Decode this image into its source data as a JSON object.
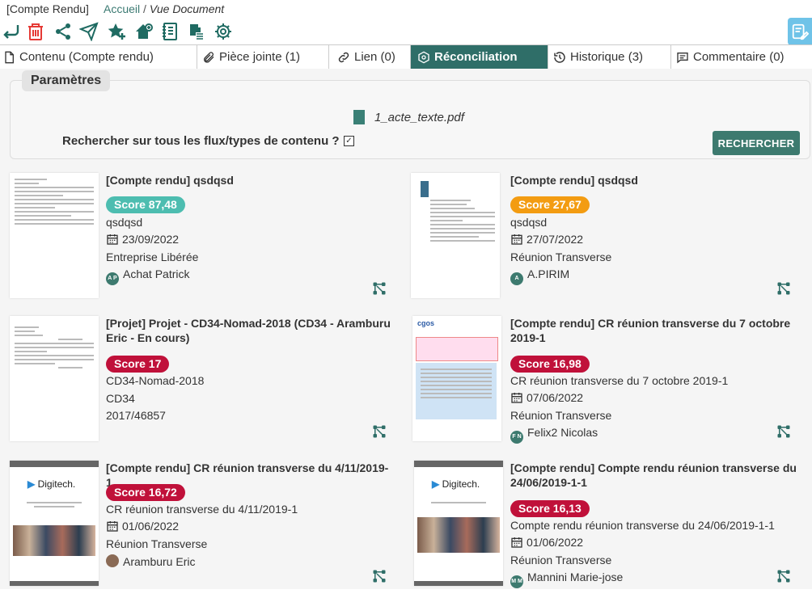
{
  "header": {
    "context": "[Compte Rendu]",
    "crumb_home": "Accueil",
    "crumb_sep": "/",
    "crumb_current": "Vue Document"
  },
  "toolbar": {
    "icons": [
      "back-icon",
      "trash-icon",
      "share-icon",
      "send-icon",
      "star-add-icon",
      "home-add-icon",
      "notebook-icon",
      "clipboard-list-icon",
      "gear-icon",
      "edit-note-icon"
    ]
  },
  "tabs": [
    {
      "label": "Contenu (Compte rendu)",
      "icon": "document-icon"
    },
    {
      "label": "Pièce jointe (1)",
      "icon": "paperclip-icon"
    },
    {
      "label": "Lien (0)",
      "icon": "link-icon"
    },
    {
      "label": "Réconciliation",
      "icon": "hexagon-icon",
      "active": true
    },
    {
      "label": "Historique (3)",
      "icon": "history-icon"
    },
    {
      "label": "Commentaire (0)",
      "icon": "comment-icon"
    }
  ],
  "params": {
    "title": "Paramètres",
    "filename": "1_acte_texte.pdf",
    "search_label": "Rechercher sur tous les flux/types de contenu ?",
    "search_checked": true,
    "search_button": "RECHERCHER"
  },
  "results": [
    {
      "title": "[Compte rendu] qsdqsd",
      "score": "Score 87,48",
      "score_color": "#4dbdb0",
      "lines": [
        "qsdqsd"
      ],
      "date": "23/09/2022",
      "org": "Entreprise Libérée",
      "author": "Achat Patrick",
      "initials": "A P"
    },
    {
      "title": "[Compte rendu] qsdqsd",
      "score": "Score 27,67",
      "score_color": "#f39c12",
      "lines": [
        "qsdqsd"
      ],
      "date": "27/07/2022",
      "org": "Réunion Transverse",
      "author": "A.PIRIM",
      "initials": "A"
    },
    {
      "title": "[Projet] Projet - CD34-Nomad-2018 (CD34 - Aramburu Eric - En cours)",
      "score": "Score 17",
      "score_color": "#c0113a",
      "lines": [
        "CD34-Nomad-2018",
        "CD34",
        "2017/46857"
      ]
    },
    {
      "title": "[Compte rendu] CR réunion transverse du 7 octobre 2019-1",
      "score": "Score 16,98",
      "score_color": "#c0113a",
      "lines": [
        "CR réunion transverse du 7 octobre 2019-1"
      ],
      "date": "07/06/2022",
      "org": "Réunion Transverse",
      "author": "Felix2 Nicolas",
      "initials": "F N"
    },
    {
      "title": "[Compte rendu] CR réunion transverse du 4/11/2019-1",
      "score": "Score 16,72",
      "score_color": "#c0113a",
      "lines": [
        "CR réunion transverse du 4/11/2019-1"
      ],
      "date": "01/06/2022",
      "org": "Réunion Transverse",
      "author": "Aramburu Eric",
      "initials": ""
    },
    {
      "title": "[Compte rendu] Compte rendu réunion transverse du 24/06/2019-1-1",
      "score": "Score 16,13",
      "score_color": "#c0113a",
      "lines": [
        "Compte rendu réunion transverse du 24/06/2019-1-1"
      ],
      "date": "01/06/2022",
      "org": "Réunion Transverse",
      "author": "Mannini Marie-jose",
      "initials": "M M"
    }
  ],
  "thumbs": {
    "digitech": "Digitech."
  }
}
